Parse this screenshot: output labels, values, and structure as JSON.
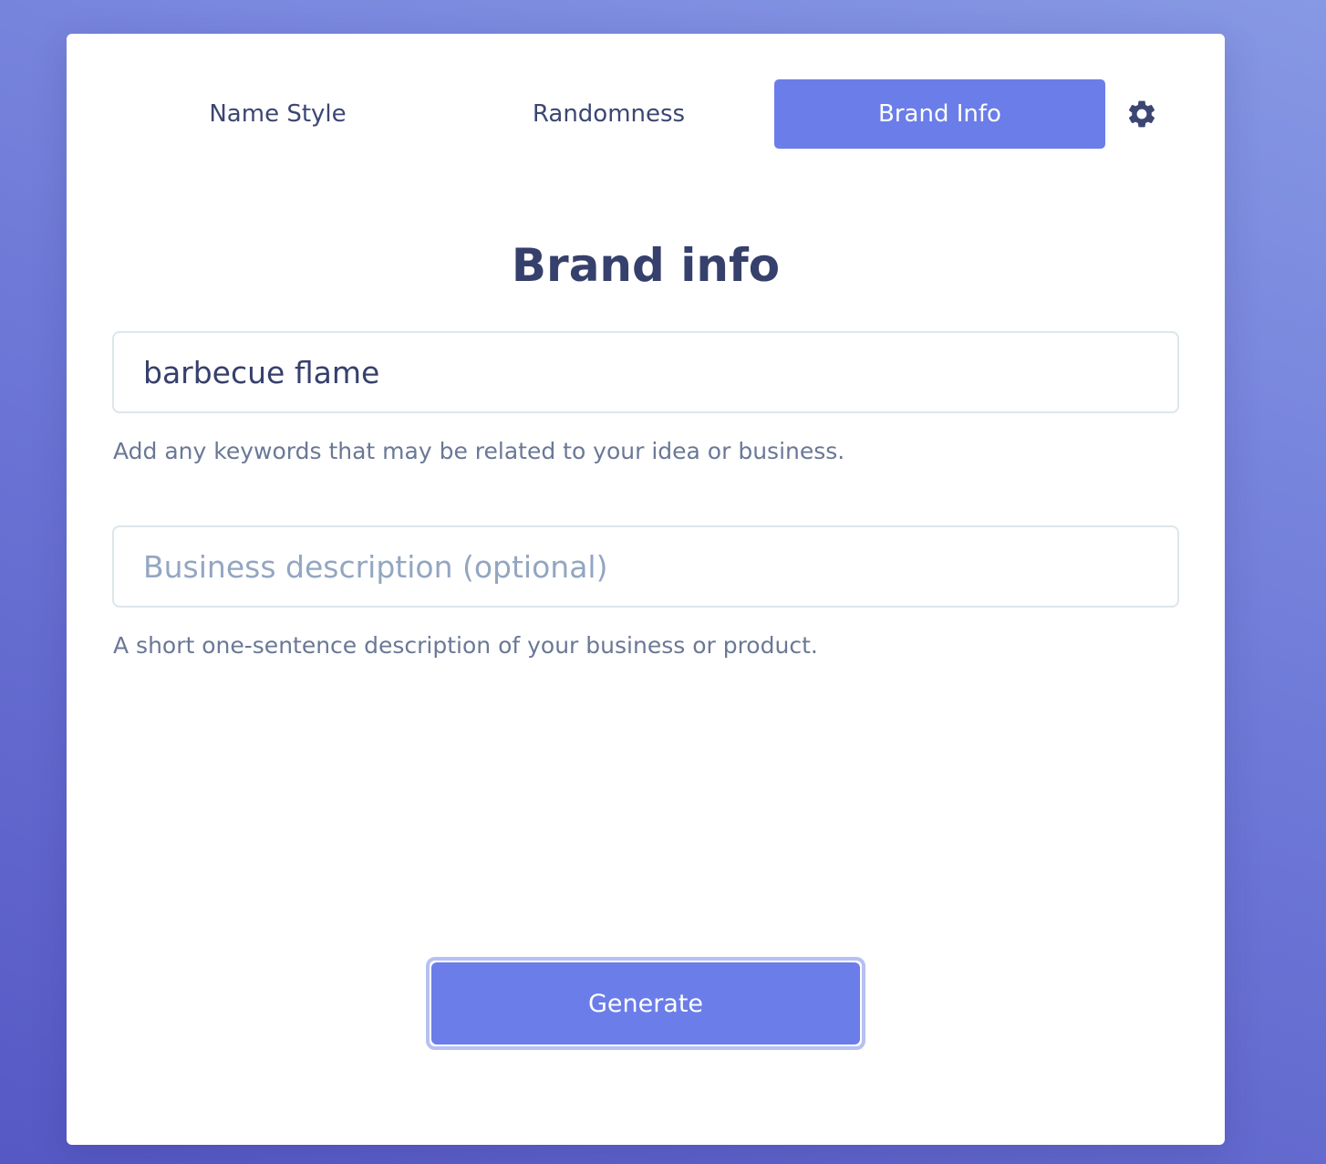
{
  "tabs": [
    {
      "label": "Name Style",
      "active": false
    },
    {
      "label": "Randomness",
      "active": false
    },
    {
      "label": "Brand Info",
      "active": true
    }
  ],
  "settings": {
    "icon": "gear-icon"
  },
  "title": "Brand info",
  "keywords": {
    "value": "barbecue flame",
    "placeholder": "",
    "hint": "Add any keywords that may be related to your idea or business."
  },
  "description": {
    "value": "",
    "placeholder": "Business description (optional)",
    "hint": "A short one-sentence description of your business or product."
  },
  "generate_label": "Generate",
  "colors": {
    "accent": "#6b7de8",
    "text": "#36406c",
    "hint": "#6a7896",
    "placeholder": "#93a6c2"
  }
}
